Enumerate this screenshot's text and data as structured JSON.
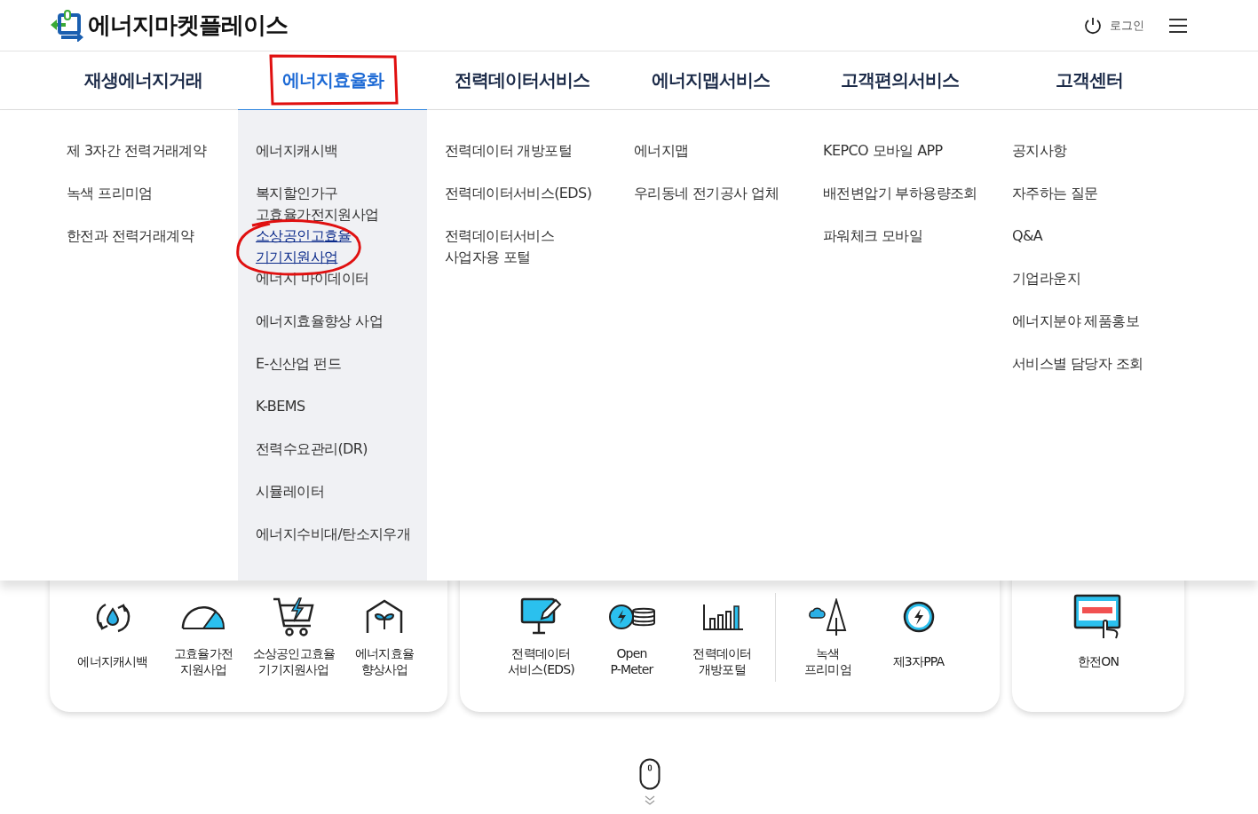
{
  "header": {
    "logo_text": "에너지마켓플레이스",
    "login": "로그인"
  },
  "nav": [
    {
      "label": "재생에너지거래",
      "selected": false,
      "items": [
        {
          "label": "제 3자간 전력거래계약",
          "selected": false
        },
        {
          "label": "녹색 프리미엄",
          "selected": false
        },
        {
          "label": "한전과 전력거래계약",
          "selected": false
        }
      ]
    },
    {
      "label": "에너지효율화",
      "selected": true,
      "items": [
        {
          "label": "에너지캐시백",
          "selected": false
        },
        {
          "label": "복지할인가구\n고효율가전지원사업",
          "selected": false
        },
        {
          "label": "소상공인고효율\n기기지원사업",
          "selected": true
        },
        {
          "label": "에너지 마이데이터",
          "selected": false
        },
        {
          "label": "에너지효율향상 사업",
          "selected": false
        },
        {
          "label": "E-신산업 펀드",
          "selected": false
        },
        {
          "label": "K-BEMS",
          "selected": false
        },
        {
          "label": "전력수요관리(DR)",
          "selected": false
        },
        {
          "label": "시뮬레이터",
          "selected": false
        },
        {
          "label": "에너지수비대/탄소지우개",
          "selected": false
        }
      ]
    },
    {
      "label": "전력데이터서비스",
      "selected": false,
      "items": [
        {
          "label": "전력데이터 개방포털",
          "selected": false
        },
        {
          "label": "전력데이터서비스(EDS)",
          "selected": false
        },
        {
          "label": "전력데이터서비스\n사업자용 포털",
          "selected": false
        }
      ]
    },
    {
      "label": "에너지맵서비스",
      "selected": false,
      "items": [
        {
          "label": "에너지맵",
          "selected": false
        },
        {
          "label": "우리동네 전기공사 업체",
          "selected": false
        }
      ]
    },
    {
      "label": "고객편의서비스",
      "selected": false,
      "items": [
        {
          "label": "KEPCO 모바일 APP",
          "selected": false
        },
        {
          "label": "배전변압기 부하용량조회",
          "selected": false
        },
        {
          "label": "파워체크 모바일",
          "selected": false
        }
      ]
    },
    {
      "label": "고객센터",
      "selected": false,
      "items": [
        {
          "label": "공지사항",
          "selected": false
        },
        {
          "label": "자주하는 질문",
          "selected": false
        },
        {
          "label": "Q&A",
          "selected": false
        },
        {
          "label": "기업라운지",
          "selected": false
        },
        {
          "label": "에너지분야 제품홍보",
          "selected": false
        },
        {
          "label": "서비스별 담당자 조회",
          "selected": false
        }
      ]
    }
  ],
  "cards": [
    {
      "groups": [
        [
          "에너지캐시백",
          "고효율가전\n지원사업",
          "소상공인고효율\n기기지원사업",
          "에너지효율\n향상사업"
        ]
      ]
    },
    {
      "groups": [
        [
          "전력데이터\n서비스(EDS)",
          "Open\nP-Meter",
          "전력데이터\n개방포털"
        ],
        [
          "녹색\n프리미엄",
          "제3자PPA"
        ]
      ]
    },
    {
      "groups": [
        [
          "한전ON"
        ]
      ]
    }
  ]
}
